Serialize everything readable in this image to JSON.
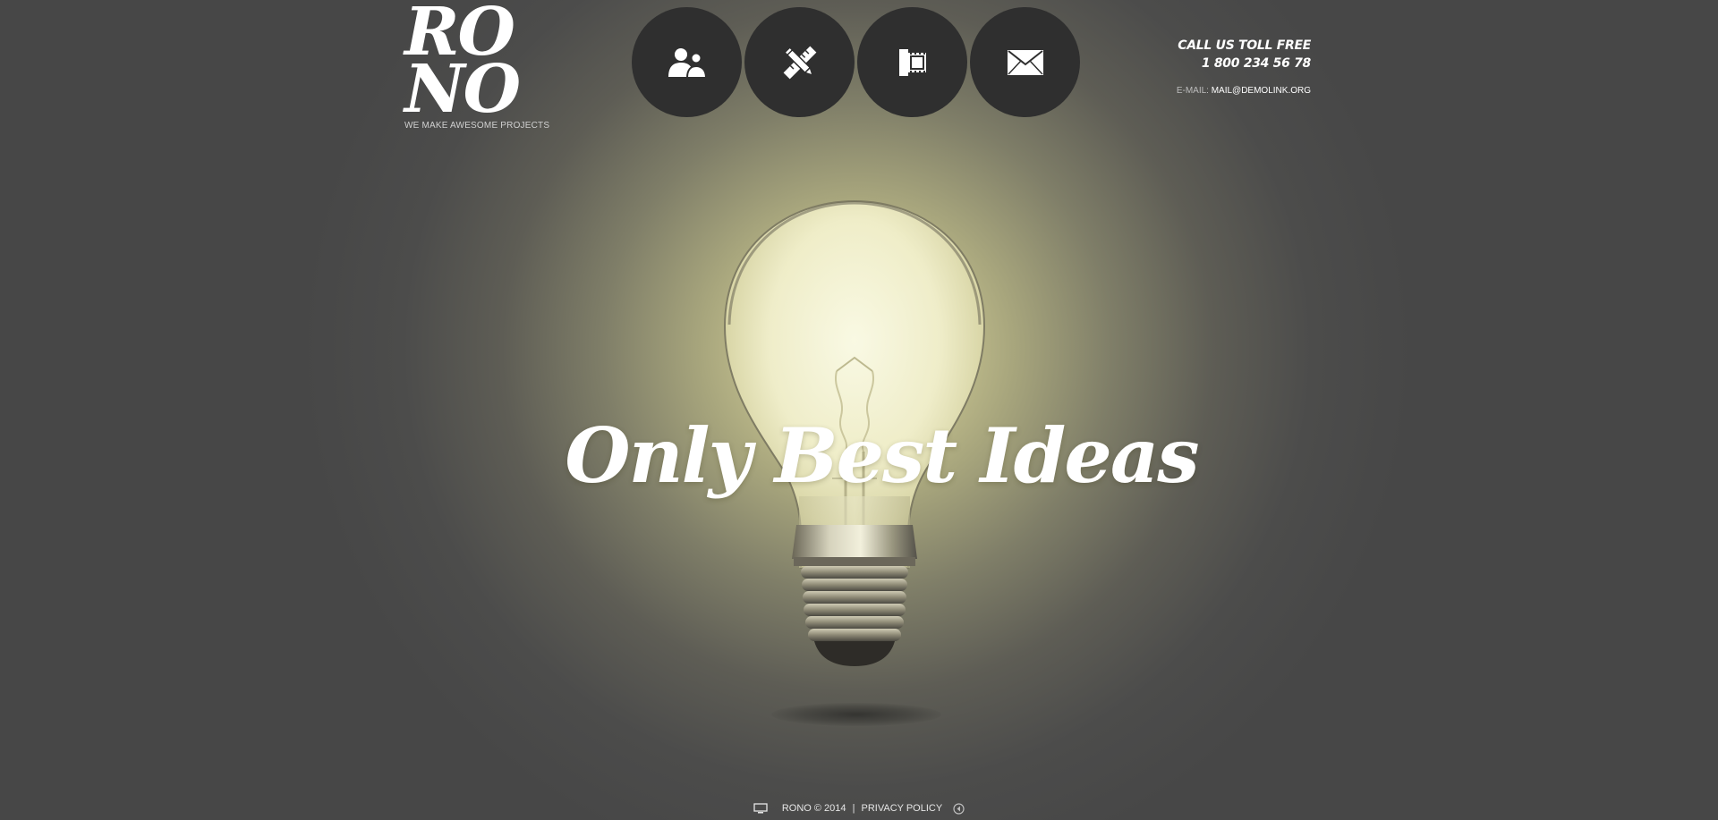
{
  "logo": {
    "line1": "RO",
    "line2": "NO",
    "tagline": "WE MAKE AWESOME PROJECTS"
  },
  "nav": [
    {
      "icon": "users-icon"
    },
    {
      "icon": "pencil-ruler-icon"
    },
    {
      "icon": "film-icon"
    },
    {
      "icon": "envelope-icon"
    }
  ],
  "contact": {
    "call_label": "CALL US TOLL FREE",
    "phone": "1 800 234 56 78",
    "email_label": "E-MAIL:",
    "email": "MAIL@DEMOLINK.ORG"
  },
  "hero": {
    "headline": "Only Best Ideas"
  },
  "footer": {
    "copyright": "RONO © 2014",
    "separator": "|",
    "privacy": "PRIVACY POLICY"
  },
  "colors": {
    "background": "#4a4a4a",
    "glow": "#d9d5a6",
    "nav_circle": "#2f2f2f",
    "text": "#ffffff"
  }
}
